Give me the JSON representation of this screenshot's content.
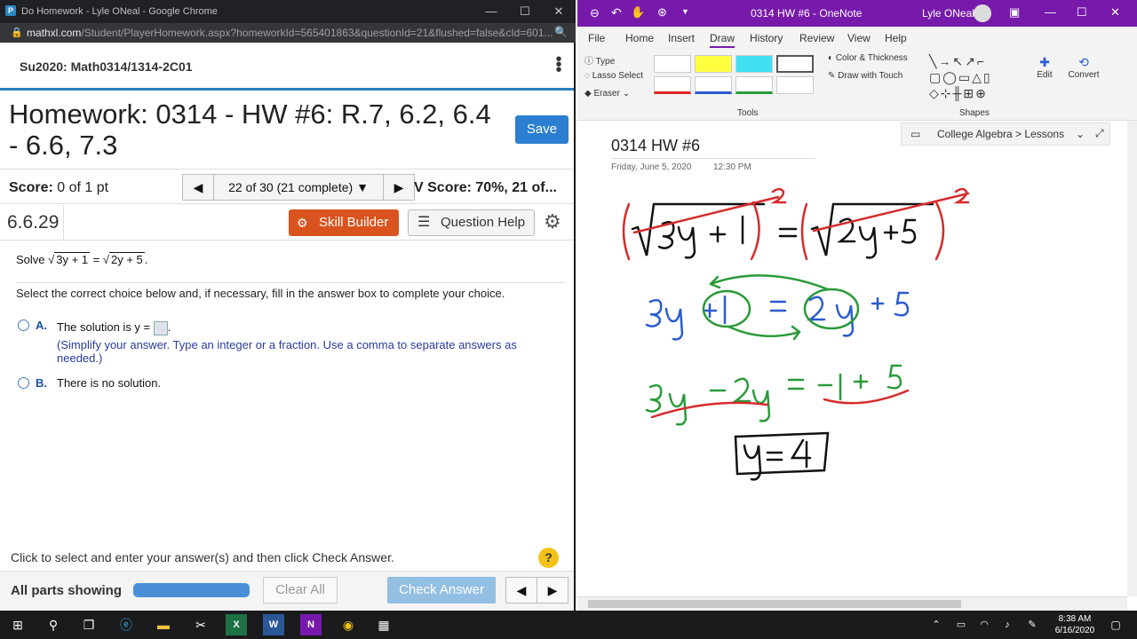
{
  "chrome": {
    "window_title": "Do Homework - Lyle ONeal - Google Chrome",
    "url_host": "mathxl.com",
    "url_path": "/Student/PlayerHomework.aspx?homeworkId=565401863&questionId=21&flushed=false&cId=601...",
    "course": "Su2020: Math0314/1314-2C01",
    "hw_title": "Homework: 0314 - HW #6: R.7, 6.2, 6.4 - 6.6, 7.3",
    "save_label": "Save",
    "score_label": "Score:",
    "score_value": "0 of 1 pt",
    "question_nav": "22 of 30 (21 complete)",
    "hw_score": "V Score: 70%, 21 of...",
    "question_number": "6.6.29",
    "skill_builder": "Skill Builder",
    "question_help": "Question Help",
    "problem_prefix": "Solve",
    "problem_lhs": "3y + 1",
    "problem_rhs": "2y + 5",
    "instructions": "Select the correct choice below and, if necessary, fill in the answer box to complete your choice.",
    "option_a_label": "A.",
    "option_a_text": "The solution is y =",
    "option_a_hint": "(Simplify your answer. Type an integer or a fraction. Use a comma to separate answers as needed.)",
    "option_b_label": "B.",
    "option_b_text": "There is no solution.",
    "bottom_tip": "Click to select and enter your answer(s) and then click Check Answer.",
    "all_parts": "All parts showing",
    "clear_all": "Clear All",
    "check_answer": "Check Answer"
  },
  "onenote": {
    "window_title": "0314 HW #6 - OneNote",
    "user": "Lyle ONeal",
    "menu": [
      "File",
      "Home",
      "Insert",
      "Draw",
      "History",
      "Review",
      "View",
      "Help"
    ],
    "tools": {
      "type": "Type",
      "lasso": "Lasso Select",
      "eraser": "Eraser",
      "color_thickness": "Color & Thickness",
      "draw_touch": "Draw with Touch",
      "tools_group": "Tools",
      "shapes_group": "Shapes",
      "edit": "Edit",
      "convert": "Convert"
    },
    "notebook_path": "College Algebra > Lessons",
    "page_title": "0314 HW #6",
    "page_date": "Friday, June 5, 2020",
    "page_time": "12:30 PM",
    "ink": {
      "line1": "(√3y + 1)² = (√2y + 5)²",
      "line2": "3y + 1 = 2y + 5",
      "line3": "3y - 2y = -1 + 5",
      "answer": "y = 4"
    }
  },
  "taskbar": {
    "time": "8:38 AM",
    "date": "6/16/2020"
  }
}
